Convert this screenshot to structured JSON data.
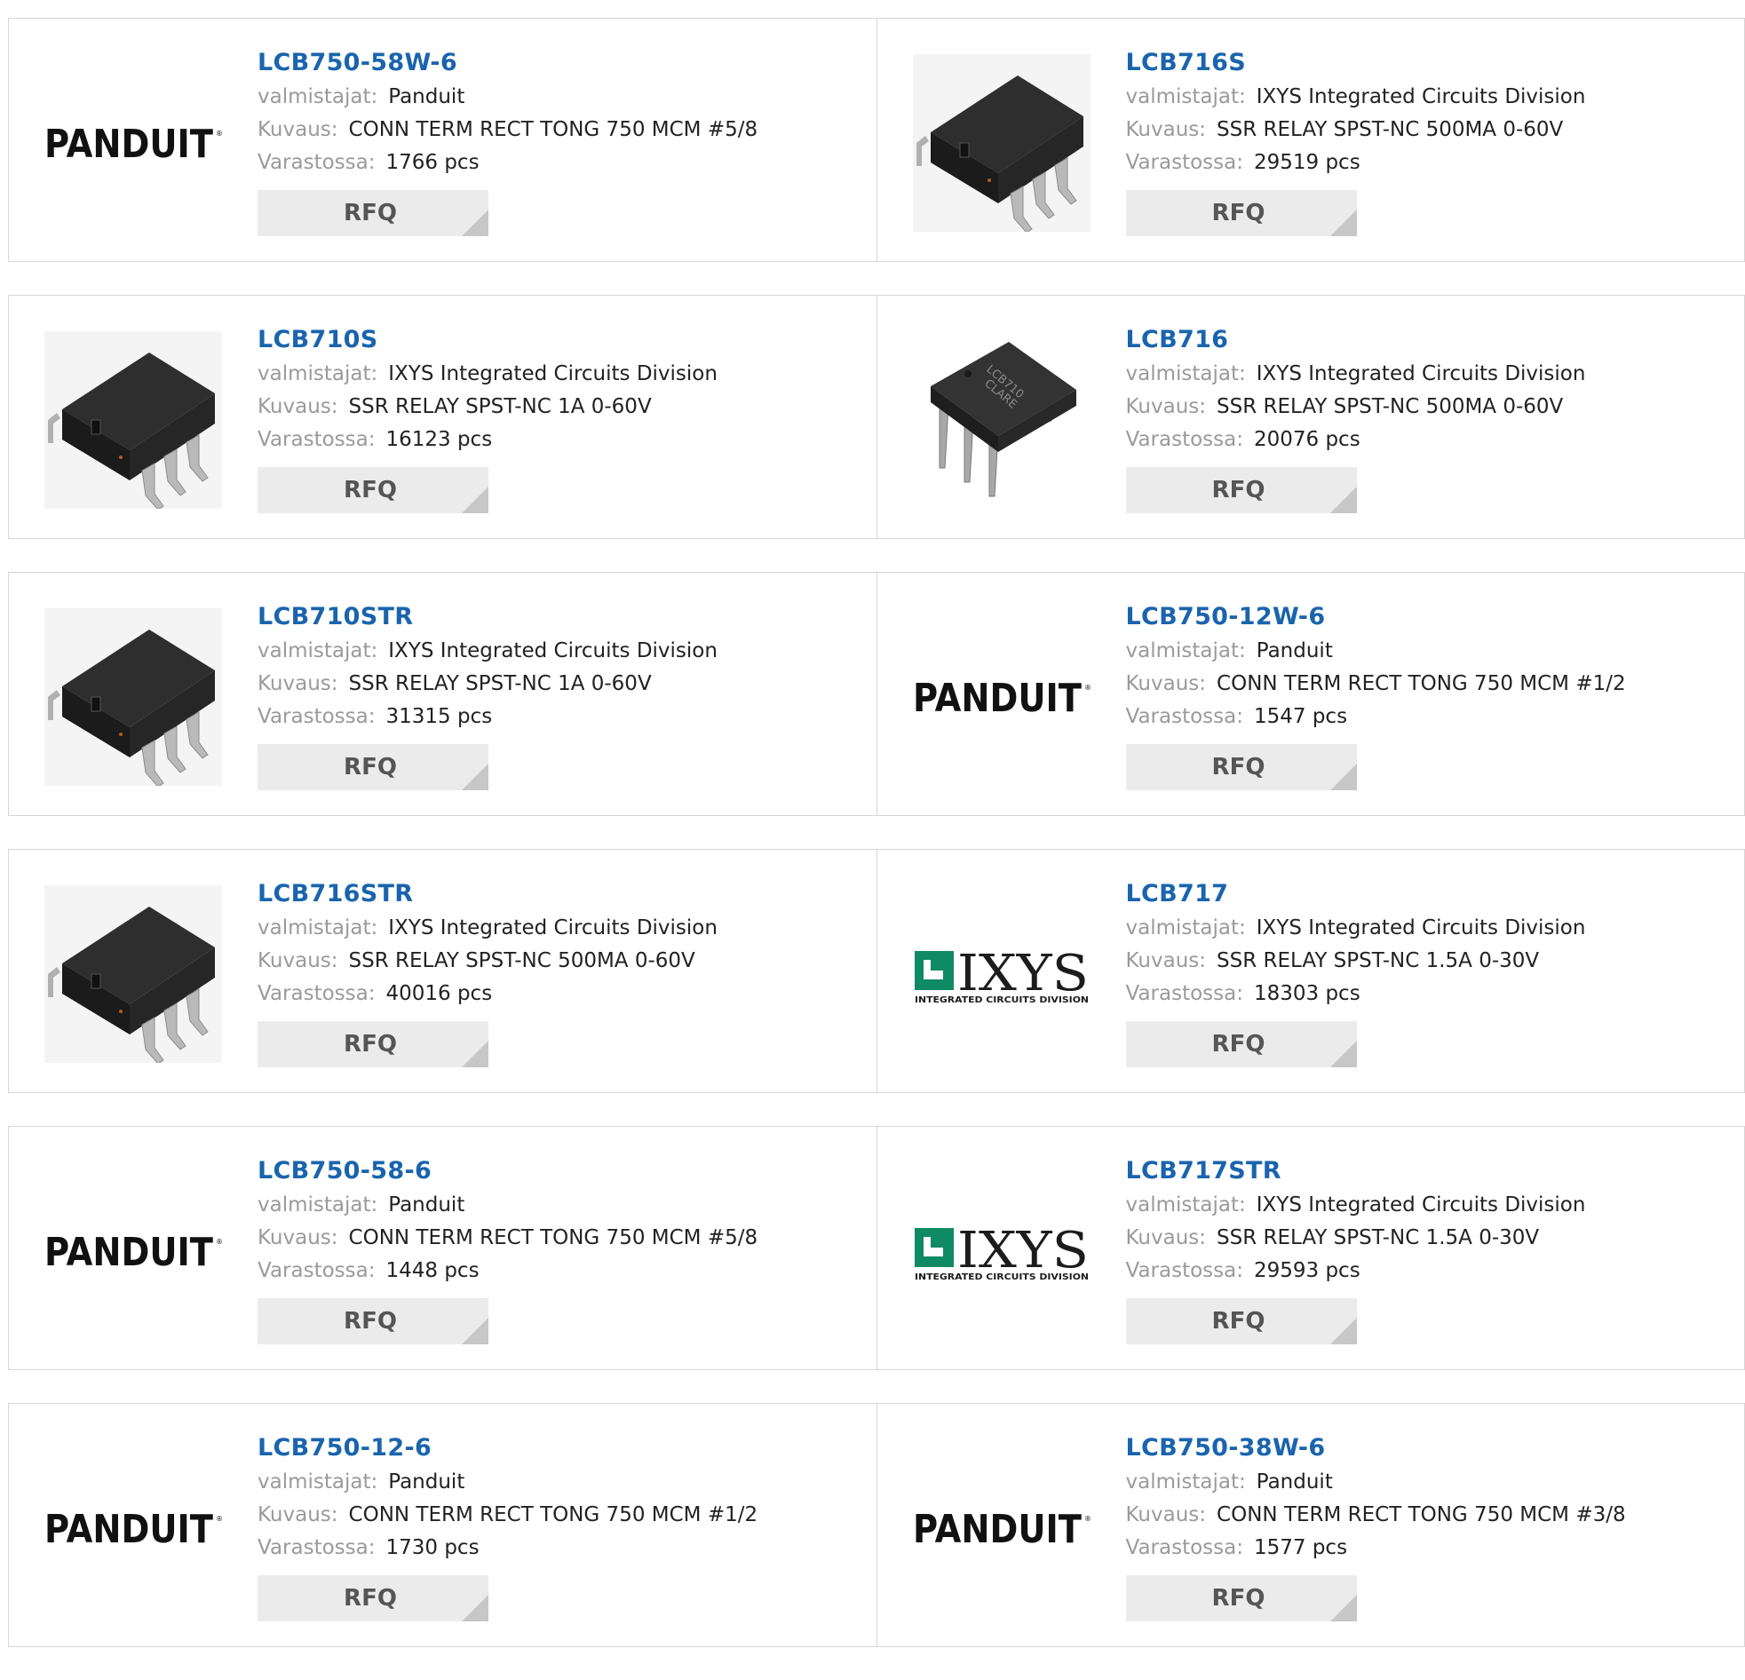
{
  "labels": {
    "manufacturer": "valmistajat:",
    "description": "Kuvaus:",
    "stock": "Varastossa:",
    "rfq": "RFQ"
  },
  "colors": {
    "part_link": "#1a64ad",
    "label": "#9a9a9a",
    "rfq_bg": "#ebebeb",
    "ixys_green": "#0f8a63"
  },
  "products": [
    {
      "part": "LCB750-58W-6",
      "manufacturer": "Panduit",
      "description": "CONN TERM RECT TONG 750 MCM #5/8",
      "stock": "1766 pcs",
      "image": "panduit-logo"
    },
    {
      "part": "LCB716S",
      "manufacturer": "IXYS Integrated Circuits Division",
      "description": "SSR RELAY SPST-NC 500MA 0-60V",
      "stock": "29519 pcs",
      "image": "smd-chip"
    },
    {
      "part": "LCB710S",
      "manufacturer": "IXYS Integrated Circuits Division",
      "description": "SSR RELAY SPST-NC 1A 0-60V",
      "stock": "16123 pcs",
      "image": "smd-chip"
    },
    {
      "part": "LCB716",
      "manufacturer": "IXYS Integrated Circuits Division",
      "description": "SSR RELAY SPST-NC 500MA 0-60V",
      "stock": "20076 pcs",
      "image": "dip-chip"
    },
    {
      "part": "LCB710STR",
      "manufacturer": "IXYS Integrated Circuits Division",
      "description": "SSR RELAY SPST-NC 1A 0-60V",
      "stock": "31315 pcs",
      "image": "smd-chip"
    },
    {
      "part": "LCB750-12W-6",
      "manufacturer": "Panduit",
      "description": "CONN TERM RECT TONG 750 MCM #1/2",
      "stock": "1547 pcs",
      "image": "panduit-logo"
    },
    {
      "part": "LCB716STR",
      "manufacturer": "IXYS Integrated Circuits Division",
      "description": "SSR RELAY SPST-NC 500MA 0-60V",
      "stock": "40016 pcs",
      "image": "smd-chip"
    },
    {
      "part": "LCB717",
      "manufacturer": "IXYS Integrated Circuits Division",
      "description": "SSR RELAY SPST-NC 1.5A 0-30V",
      "stock": "18303 pcs",
      "image": "ixys-logo"
    },
    {
      "part": "LCB750-58-6",
      "manufacturer": "Panduit",
      "description": "CONN TERM RECT TONG 750 MCM #5/8",
      "stock": "1448 pcs",
      "image": "panduit-logo"
    },
    {
      "part": "LCB717STR",
      "manufacturer": "IXYS Integrated Circuits Division",
      "description": "SSR RELAY SPST-NC 1.5A 0-30V",
      "stock": "29593 pcs",
      "image": "ixys-logo"
    },
    {
      "part": "LCB750-12-6",
      "manufacturer": "Panduit",
      "description": "CONN TERM RECT TONG 750 MCM #1/2",
      "stock": "1730 pcs",
      "image": "panduit-logo"
    },
    {
      "part": "LCB750-38W-6",
      "manufacturer": "Panduit",
      "description": "CONN TERM RECT TONG 750 MCM #3/8",
      "stock": "1577 pcs",
      "image": "panduit-logo"
    }
  ],
  "logo_text": {
    "panduit": "PANDUIT",
    "ixys": "IXYS",
    "ixys_sub": "INTEGRATED CIRCUITS DIVISION",
    "dip_marking_1": "LCB710",
    "dip_marking_2": "CLARE"
  }
}
